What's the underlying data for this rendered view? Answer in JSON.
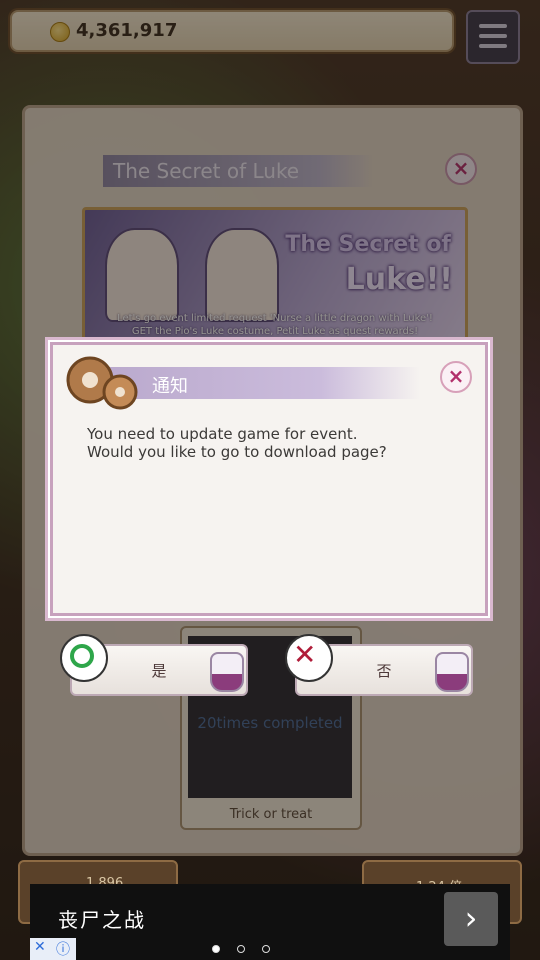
{
  "top_bar": {
    "coins": "4,361,917"
  },
  "panel": {
    "title": "The Secret of Luke",
    "close": "×",
    "banner": {
      "title_line1": "The Secret of",
      "title_line2": "Luke!!",
      "desc_line1": "Let's go event limited request 'Nurse a little dragon with Luke'!",
      "desc_line2": "GET the Pio's Luke costume, Petit Luke as quest rewards!"
    },
    "quest": {
      "status": "20times completed",
      "name": "Trick or treat"
    }
  },
  "dialog": {
    "title": "通知",
    "close": "×",
    "message_line1": "You need to update game for event.",
    "message_line2": "Would you like to go to download page?",
    "yes_label": "是",
    "no_label": "否"
  },
  "bottom": {
    "left_value": "1,896",
    "right_value": "1,24 倍"
  },
  "ad": {
    "text": "丧尸之战",
    "arrow": "›"
  },
  "colors": {
    "accent": "#b2306c",
    "ok": "#2ea64a",
    "cancel": "#b01d3a"
  }
}
